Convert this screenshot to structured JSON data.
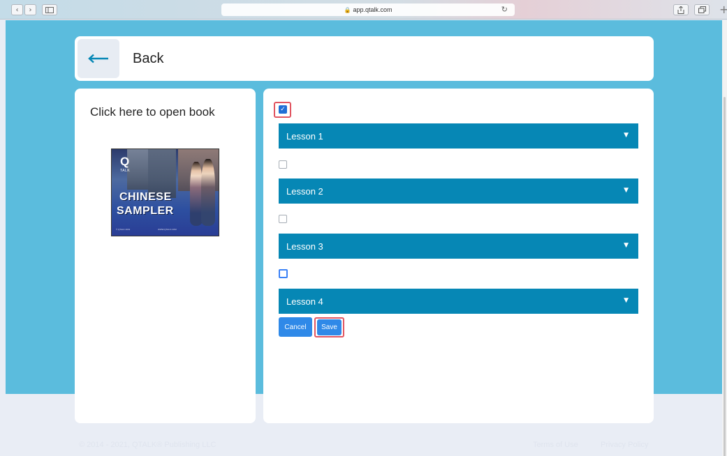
{
  "browser": {
    "url": "app.qtalk.com",
    "reload_glyph": "↻",
    "back_glyph": "‹",
    "forward_glyph": "›",
    "new_tab_glyph": "+"
  },
  "back": {
    "label": "Back"
  },
  "book": {
    "open_label": "Click here to open book",
    "cover": {
      "logo_letter": "Q",
      "logo_text": "TALK",
      "line1": "CHINESE",
      "line2": "SAMPLER",
      "footer_left": "© QTALK 2019",
      "footer_right": "WWW.QTALK.COM"
    }
  },
  "lessons": [
    {
      "label": "Lesson 1",
      "checked": true
    },
    {
      "label": "Lesson 2",
      "checked": false
    },
    {
      "label": "Lesson 3",
      "checked": false
    },
    {
      "label": "Lesson 4",
      "checked": false
    }
  ],
  "actions": {
    "cancel": "Cancel",
    "save": "Save"
  },
  "footer": {
    "copyright": "© 2014 - 2021, QTALK® Publishing LLC",
    "terms": "Terms of Use",
    "privacy": "Privacy Policy"
  },
  "colors": {
    "page_blue": "#5bbcdd",
    "lesson_bar": "#0687b5",
    "button_blue": "#2f89e8",
    "highlight_red": "#e15561"
  }
}
